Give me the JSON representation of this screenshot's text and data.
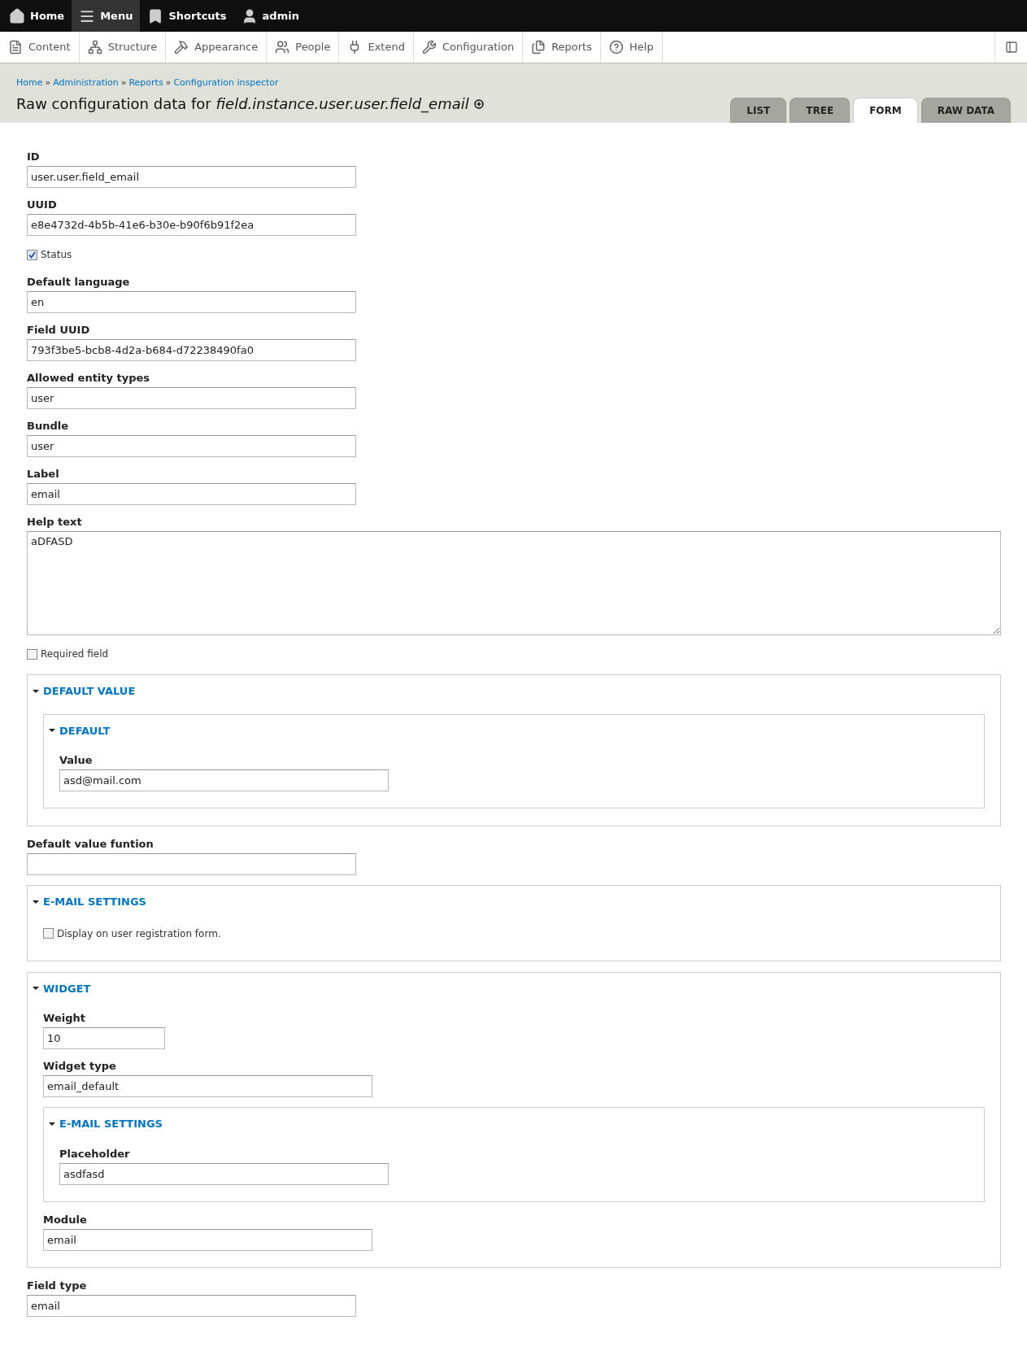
{
  "top_bar": {
    "items": [
      {
        "label": "Home",
        "selected": false
      },
      {
        "label": "Menu",
        "selected": true
      },
      {
        "label": "Shortcuts",
        "selected": false
      },
      {
        "label": "admin",
        "selected": false
      }
    ]
  },
  "toolbar": {
    "items": [
      "Content",
      "Structure",
      "Appearance",
      "People",
      "Extend",
      "Configuration",
      "Reports",
      "Help"
    ]
  },
  "breadcrumb": {
    "links": [
      "Home",
      "Administration",
      "Reports",
      "Configuration inspector"
    ],
    "separator": "»"
  },
  "page_title": "Raw configuration data for *field.instance.user.user.field_email*",
  "tabs": [
    {
      "label": "LIST",
      "selected": false
    },
    {
      "label": "TREE",
      "selected": false
    },
    {
      "label": "FORM",
      "selected": true
    },
    {
      "label": "RAW DATA",
      "selected": false
    }
  ],
  "form": [
    {
      "kind": "text",
      "label": "ID",
      "value": "user.user.field_email"
    },
    {
      "kind": "text",
      "label": "UUID",
      "value": "e8e4732d-4b5b-41e6-b30e-b90f6b91f2ea"
    },
    {
      "kind": "checkbox",
      "label": "Status",
      "checked": true
    },
    {
      "kind": "text",
      "label": "Default language",
      "value": "en"
    },
    {
      "kind": "text",
      "label": "Field UUID",
      "value": "793f3be5-bcb8-4d2a-b684-d72238490fa0"
    },
    {
      "kind": "text",
      "label": "Allowed entity types",
      "value": "user"
    },
    {
      "kind": "text",
      "label": "Bundle",
      "value": "user"
    },
    {
      "kind": "text",
      "label": "Label",
      "value": "email"
    },
    {
      "kind": "textarea",
      "label": "Help text",
      "value": "aDFASD"
    },
    {
      "kind": "checkbox",
      "label": "Required field",
      "checked": false
    },
    {
      "kind": "fieldset",
      "title": "DEFAULT VALUE",
      "expanded": true,
      "children": [
        {
          "kind": "fieldset",
          "title": "DEFAULT",
          "expanded": true,
          "children": [
            {
              "kind": "text",
              "label": "Value",
              "value": "asd@mail.com"
            }
          ]
        }
      ]
    },
    {
      "kind": "text",
      "label": "Default value funtion"
    },
    {
      "kind": "fieldset",
      "title": "E-MAIL SETTINGS",
      "expanded": true,
      "children": [
        {
          "kind": "checkbox",
          "label": "Display on user registration form.",
          "checked": false
        }
      ]
    },
    {
      "kind": "fieldset",
      "title": "WIDGET",
      "expanded": true,
      "children": [
        {
          "kind": "number",
          "label": "Weight",
          "value": "10"
        },
        {
          "kind": "text",
          "label": "Widget type",
          "value": "email_default"
        },
        {
          "kind": "fieldset",
          "title": "E-MAIL SETTINGS",
          "expanded": true,
          "children": [
            {
              "kind": "text",
              "label": "Placeholder",
              "value": "asdfasd"
            }
          ]
        },
        {
          "kind": "text",
          "label": "Module",
          "value": "email"
        }
      ]
    },
    {
      "kind": "text",
      "label": "Field type",
      "value": "email"
    }
  ]
}
